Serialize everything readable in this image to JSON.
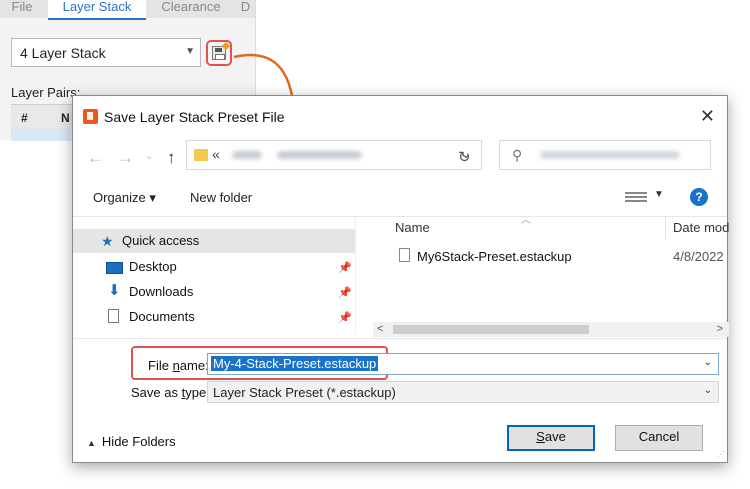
{
  "background": {
    "tabs": [
      "File",
      "Layer Stack",
      "Clearance",
      "D"
    ],
    "active_tab": "Layer Stack",
    "stack_select": {
      "value": "4 Layer Stack"
    },
    "layer_pairs_label": "Layer Pairs:",
    "table_headers": [
      "#",
      "N"
    ],
    "save_preset_icon": "save-preset-icon"
  },
  "dialog": {
    "title": "Save Layer Stack Preset File",
    "address": {
      "prefix": "«"
    },
    "toolbar": {
      "organize": "Organize ▾",
      "new_folder": "New folder"
    },
    "nav": {
      "items": [
        {
          "label": "Quick access",
          "icon": "star-icon"
        },
        {
          "label": "Desktop",
          "icon": "desktop-icon"
        },
        {
          "label": "Downloads",
          "icon": "download-icon"
        },
        {
          "label": "Documents",
          "icon": "document-icon"
        }
      ]
    },
    "list": {
      "columns": [
        "Name",
        "Date mod"
      ],
      "files": [
        {
          "name": "My6Stack-Preset.estackup",
          "date": "4/8/2022"
        }
      ]
    },
    "file_name": {
      "label_pre": "File ",
      "label_ul": "n",
      "label_post": "ame:",
      "value": "My-4-Stack-Preset.estackup"
    },
    "save_as_type": {
      "label_pre": "Save as ",
      "label_ul": "t",
      "label_post": "ype:",
      "value": "Layer Stack Preset (*.estackup)"
    },
    "hide_folders": "Hide Folders",
    "save_button": {
      "ul": "S",
      "rest": "ave"
    },
    "cancel_button": "Cancel",
    "accent_color": "#1a73c9",
    "highlight_color": "#e05353"
  }
}
